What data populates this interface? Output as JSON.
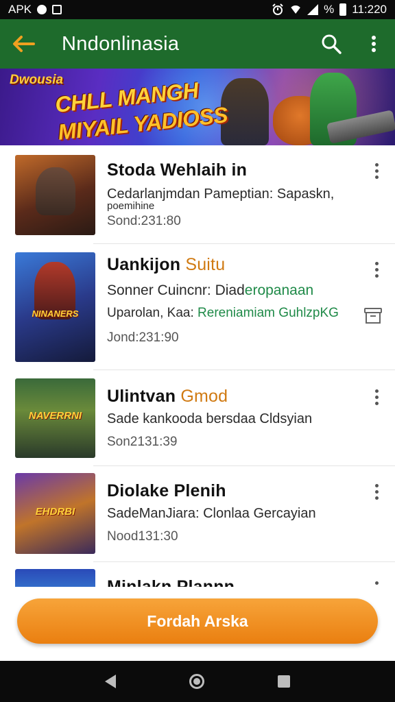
{
  "status_bar": {
    "left_text": "APK",
    "time": "11:220",
    "icons": [
      "notification-icon",
      "screenshot-icon",
      "alarm-icon",
      "wifi-icon",
      "signal-icon",
      "battery-icon"
    ],
    "battery_text": "%"
  },
  "app_bar": {
    "title": "Nndonlinasia",
    "background": "#1e6b2c",
    "accent": "#f0a020",
    "icons": [
      "back-arrow-icon",
      "search-icon",
      "more-vert-icon"
    ]
  },
  "banner": {
    "small_text": "Dwousia",
    "line1": "CHLL MANGH",
    "line2": "MIYAIL YADIOSS"
  },
  "items": [
    {
      "title": "Stoda Wehlaih in",
      "title_accent": "",
      "line1": "Cedarlanjmdan Pameptian: Sapaskn,",
      "line1_green": "",
      "line2": "poemihine",
      "line2_green": "",
      "meta": "Sond:231:80",
      "thumb_label": "",
      "has_archive": false
    },
    {
      "title": "Uankijon",
      "title_accent": "Suitu",
      "line1": "Sonner Cuincnr: Diad",
      "line1_green": "eropanaan",
      "line2": "Uparolan, Kaa:",
      "line2_green": "Rereniamiam GuhlzpKG",
      "meta": "Jond:231:90",
      "thumb_label": "NINANERS",
      "has_archive": true
    },
    {
      "title": "Ulintvan",
      "title_accent": "Gmod",
      "line1": "Sade kankooda bersdaa Cldsyian",
      "line1_green": "",
      "line2": "",
      "line2_green": "",
      "meta": "Son2131:39",
      "thumb_label": "NAVERRNI",
      "has_archive": false
    },
    {
      "title": "Diolake Plenih",
      "title_accent": "",
      "line1": "SadeManJiara: Clonlaa Gercayian",
      "line1_green": "",
      "line2": "",
      "line2_green": "",
      "meta": "Nood131:30",
      "thumb_label": "EHDRBI",
      "has_archive": false
    },
    {
      "title": "Minlakn Plannn",
      "title_accent": "",
      "line1": "",
      "line1_green": "",
      "line2": "",
      "line2_green": "",
      "meta": "",
      "thumb_label": "",
      "has_archive": false
    }
  ],
  "primary_button": {
    "label": "Fordah Arska",
    "color": "#ee8a1c"
  },
  "nav_bar": {
    "icons": [
      "nav-back-icon",
      "nav-home-icon",
      "nav-recents-icon"
    ]
  }
}
